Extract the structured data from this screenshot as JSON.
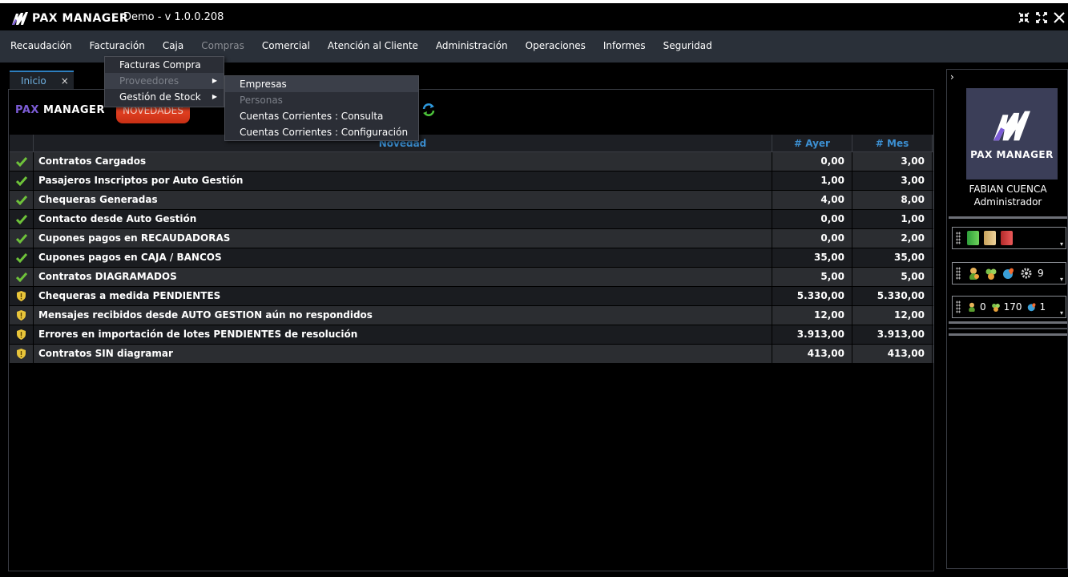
{
  "app": {
    "logo_text": "PAX MANAGER",
    "title": "Demo - v 1.0.0.208"
  },
  "menu": {
    "items": [
      {
        "label": "Recaudación"
      },
      {
        "label": "Facturación"
      },
      {
        "label": "Caja"
      },
      {
        "label": "Compras"
      },
      {
        "label": "Comercial"
      },
      {
        "label": "Atención al Cliente"
      },
      {
        "label": "Administración"
      },
      {
        "label": "Operaciones"
      },
      {
        "label": "Informes"
      },
      {
        "label": "Seguridad"
      }
    ],
    "compras_dropdown": [
      {
        "label": "Facturas Compra"
      },
      {
        "label": "Proveedores"
      },
      {
        "label": "Gestión de Stock"
      }
    ],
    "proveedores_submenu": [
      {
        "label": "Empresas"
      },
      {
        "label": "Personas"
      },
      {
        "label": "Cuentas Corrientes : Consulta"
      },
      {
        "label": "Cuentas Corrientes : Configuración"
      }
    ]
  },
  "tabs": [
    {
      "label": "Inicio",
      "close": "×"
    }
  ],
  "panel": {
    "logo_pax": "PAX",
    "logo_mgr": "MANAGER",
    "news_badge": "NOVEDADES"
  },
  "table": {
    "headers": {
      "novedad": "Novedad",
      "ayer": "# Ayer",
      "mes": "# Mes"
    },
    "rows": [
      {
        "icon": "check",
        "text": "Contratos Cargados",
        "ayer": "0,00",
        "mes": "3,00"
      },
      {
        "icon": "check",
        "text": "Pasajeros Inscriptos por Auto Gestión",
        "ayer": "1,00",
        "mes": "3,00"
      },
      {
        "icon": "check",
        "text": "Chequeras Generadas",
        "ayer": "4,00",
        "mes": "8,00"
      },
      {
        "icon": "check",
        "text": "Contacto desde Auto Gestión",
        "ayer": "0,00",
        "mes": "1,00"
      },
      {
        "icon": "check",
        "text": "Cupones pagos en RECAUDADORAS",
        "ayer": "0,00",
        "mes": "2,00"
      },
      {
        "icon": "check",
        "text": "Cupones pagos en CAJA / BANCOS",
        "ayer": "35,00",
        "mes": "35,00"
      },
      {
        "icon": "check",
        "text": "Contratos DIAGRAMADOS",
        "ayer": "5,00",
        "mes": "5,00"
      },
      {
        "icon": "shield",
        "text": "Chequeras a medida PENDIENTES",
        "ayer": "5.330,00",
        "mes": "5.330,00"
      },
      {
        "icon": "shield",
        "text": "Mensajes recibidos desde AUTO GESTION aún no respondidos",
        "ayer": "12,00",
        "mes": "12,00"
      },
      {
        "icon": "shield",
        "text": "Errores en importación de lotes PENDIENTES de resolución",
        "ayer": "3.913,00",
        "mes": "3.913,00"
      },
      {
        "icon": "shield",
        "text": "Contratos SIN diagramar",
        "ayer": "413,00",
        "mes": "413,00"
      }
    ]
  },
  "sidebar": {
    "toggle": "›",
    "avatar_text": "PAX MANAGER",
    "user_name": "FABIAN CUENCA",
    "user_role": "Administrador",
    "widget2_count": "9",
    "widget3_a": "0",
    "widget3_b": "170",
    "widget3_c": "1"
  },
  "colors": {
    "check": "#6ec23a",
    "shield": "#e9c53a",
    "header_text": "#3c8fd1",
    "accent_purple": "#7c5cd6",
    "badge_red": "#e03c1e"
  }
}
